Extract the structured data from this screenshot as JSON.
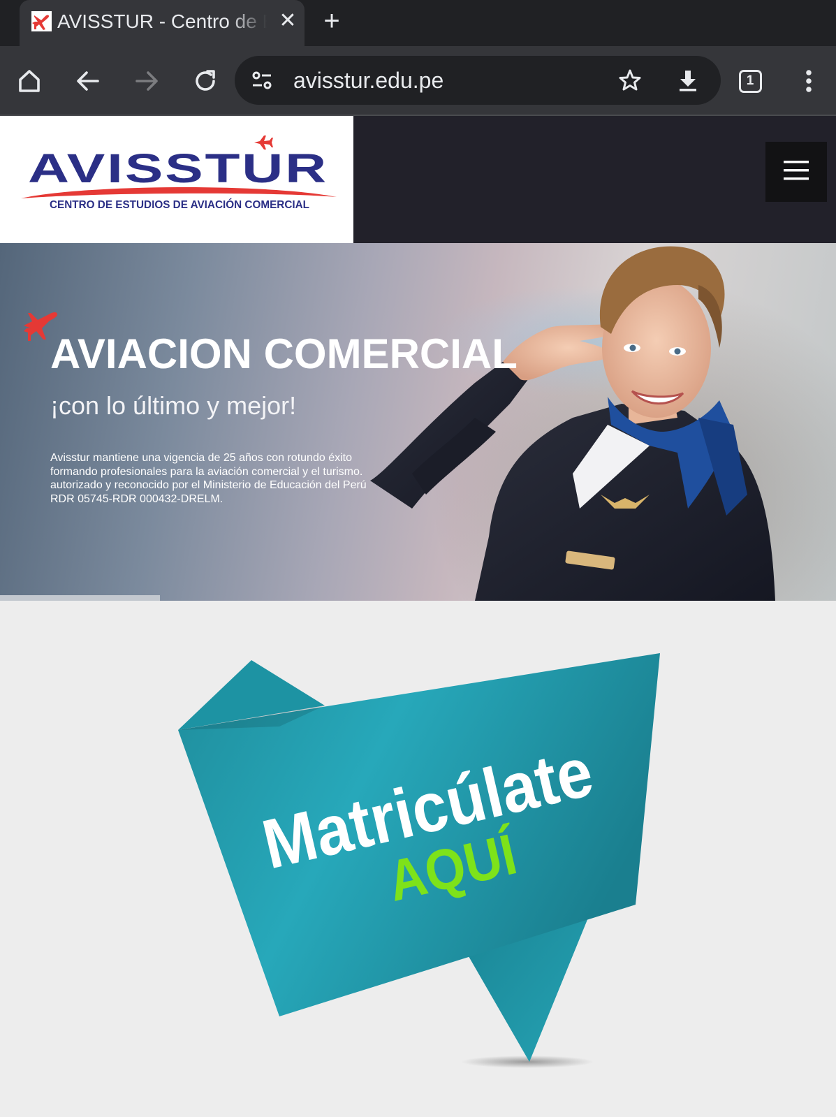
{
  "browser": {
    "tab_title": "AVISSTUR - Centro de Estudios de Aviación Comercial",
    "tab_close": "✕",
    "new_tab": "+",
    "url": "avisstur.edu.pe",
    "tab_count": "1"
  },
  "site": {
    "logo": {
      "name": "AVISSTUR",
      "tagline": "CENTRO DE ESTUDIOS DE AVIACIÓN COMERCIAL"
    }
  },
  "hero": {
    "title": "AVIACION COMERCIAL",
    "subtitle": "¡con lo último y mejor!",
    "description": [
      "Avisstur mantiene una vigencia de 25 años con rotundo éxito",
      "formando profesionales para la aviación comercial y el turismo.",
      "autorizado y reconocido por el Ministerio de Educación del Perú",
      "RDR 05745-RDR 000432-DRELM."
    ]
  },
  "promo": {
    "line1": "Matricúlate",
    "line2": "AQUÍ"
  },
  "colors": {
    "accent_red": "#e53935",
    "logo_blue": "#2b2f86",
    "promo_teal": "#1e98a8",
    "promo_green": "#7ee21a"
  }
}
